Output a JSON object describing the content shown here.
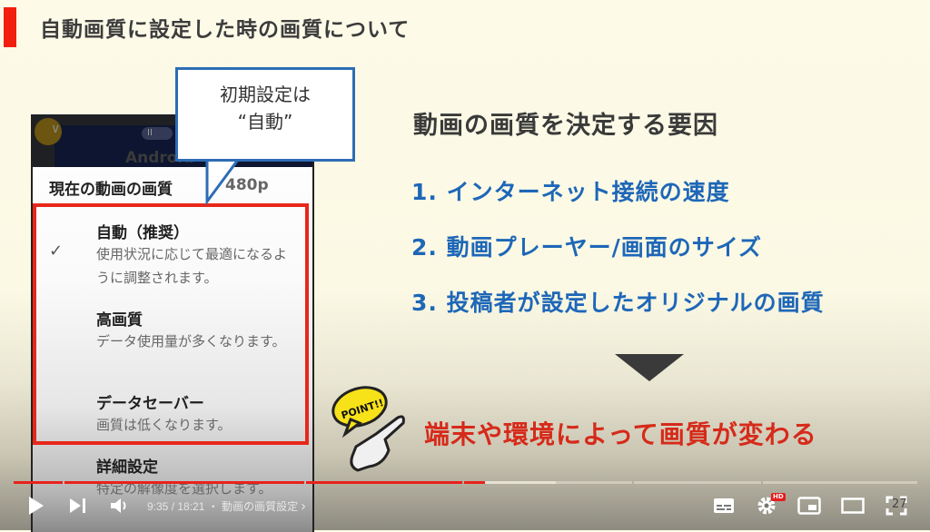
{
  "slide": {
    "title": "自動画質に設定した時の画質について",
    "callout": {
      "line1": "初期設定は",
      "line2": "“自動”"
    },
    "phone": {
      "video_label": "Android",
      "current_quality_label": "現在の動画の画質",
      "current_quality_value": "480p",
      "options": [
        {
          "name": "自動（推奨）",
          "desc": "使用状況に応じて最適になるように調整されます。",
          "selected": true
        },
        {
          "name": "高画質",
          "desc": "データ使用量が多くなります。",
          "selected": false
        },
        {
          "name": "データセーバー",
          "desc": "画質は低くなります。",
          "selected": false
        },
        {
          "name": "詳細設定",
          "desc": "特定の解像度を選択します。",
          "selected": false
        }
      ]
    },
    "factors_title": "動画の画質を決定する要因",
    "factors": [
      "1.  インターネット接続の速度",
      "2.  動画プレーヤー/画面のサイズ",
      "3.  投稿者が設定したオリジナルの画質"
    ],
    "point_badge": "POINT!!",
    "conclusion": "端末や環境によって画質が変わる",
    "page_number": "27"
  },
  "player": {
    "current_time": "9:35",
    "duration": "18:21",
    "time_display": "9:35 / 18:21",
    "chapter_separator": "・",
    "chapter_title": "動画の画質設定",
    "chapter_chevron": "›",
    "progress_played_fraction": 0.522,
    "progress_buffered_fraction": 0.6,
    "chapter_breaks_fraction": [
      0.054,
      0.322,
      0.496,
      0.684,
      0.827
    ],
    "hd_badge": "HD",
    "colors": {
      "played": "#e8221b",
      "buffered": "#e6e3d4",
      "track": "#cfccbe"
    },
    "buttons": {
      "play": "play-icon",
      "next": "next-icon",
      "volume": "volume-icon",
      "subtitles": "subtitles-icon",
      "settings": "settings-gear-icon",
      "miniplayer": "miniplayer-icon",
      "theater": "theater-mode-icon",
      "fullscreen": "fullscreen-icon"
    }
  }
}
